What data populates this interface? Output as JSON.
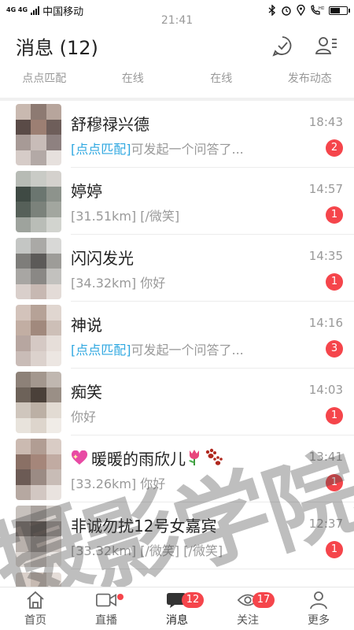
{
  "status_bar": {
    "network": "4G 4G",
    "carrier": "中国移动",
    "time": "21:41"
  },
  "header": {
    "title": "消息 (12)"
  },
  "subtabs": [
    "点点匹配",
    "在线",
    "在线",
    "发布动态"
  ],
  "messages": [
    {
      "name": "舒穆禄兴德",
      "time": "18:43",
      "tag": "[点点匹配]",
      "preview": "可发起一个问答了...",
      "badge": "2"
    },
    {
      "name": "婷婷",
      "time": "14:57",
      "tag": "",
      "preview": "[31.51km] [/微笑]",
      "badge": "1"
    },
    {
      "name": "闪闪发光",
      "time": "14:35",
      "tag": "",
      "preview": "[34.32km] 你好",
      "badge": "1"
    },
    {
      "name": "神说",
      "time": "14:16",
      "tag": "[点点匹配]",
      "preview": "可发起一个问答了...",
      "badge": "3"
    },
    {
      "name": "痴笑",
      "time": "14:03",
      "tag": "",
      "preview": "你好",
      "badge": "1"
    },
    {
      "name": "暖暖的雨欣儿",
      "time": "13:41",
      "tag": "",
      "preview": "[33.26km] 你好",
      "badge": "1"
    },
    {
      "name": "非诚勿扰12号女嘉宾",
      "time": "12:37",
      "tag": "",
      "preview": "[33.32km] [/微笑] [/微笑]",
      "badge": "1"
    }
  ],
  "nav": {
    "home": "首页",
    "live": "直播",
    "messages": "消息",
    "messages_badge": "12",
    "follow": "关注",
    "follow_badge": "17",
    "more": "更多"
  },
  "watermark": "摄影学院",
  "colors": {
    "badge": "#f5454b",
    "tag": "#2ea7e0",
    "time": "#999999"
  }
}
